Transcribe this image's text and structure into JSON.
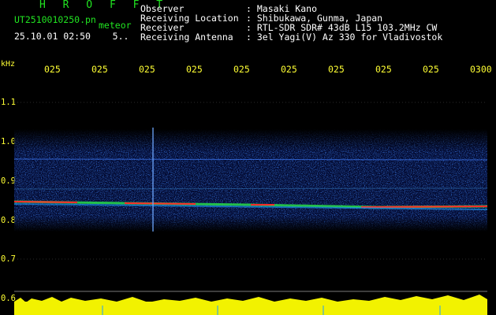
{
  "header": {
    "logo": "H R O F F T",
    "filename": "UT2510010250.pn",
    "meteor_label": "meteor",
    "datetime": "25.10.01 02:50",
    "count": "5.."
  },
  "station_info": [
    {
      "key": "Observer",
      "value": ": Masaki Kano"
    },
    {
      "key": "Receiving Location",
      "value": ": Shibukawa, Gunma, Japan"
    },
    {
      "key": "Receiver",
      "value": ": RTL-SDR SDR# 43dB L15 103.2MHz CW"
    },
    {
      "key": "Receiving Antenna",
      "value": ": 3el Yagi(V) Az 330 for Vladivostok"
    }
  ],
  "y_axis": {
    "unit": "kHz",
    "ticks": [
      "1.1",
      "1.0",
      "0.9",
      "0.8",
      "0.7",
      "0.6"
    ]
  },
  "x_axis": {
    "ticks": [
      "025",
      "025",
      "025",
      "025",
      "025",
      "025",
      "025",
      "025",
      "025",
      "0300"
    ]
  },
  "colors": {
    "background": "#000000",
    "header_green": "#21e321",
    "tick_yellow": "#ffff33",
    "echo_red": "#ff2020",
    "noise_blue": "#1a3cff"
  }
}
